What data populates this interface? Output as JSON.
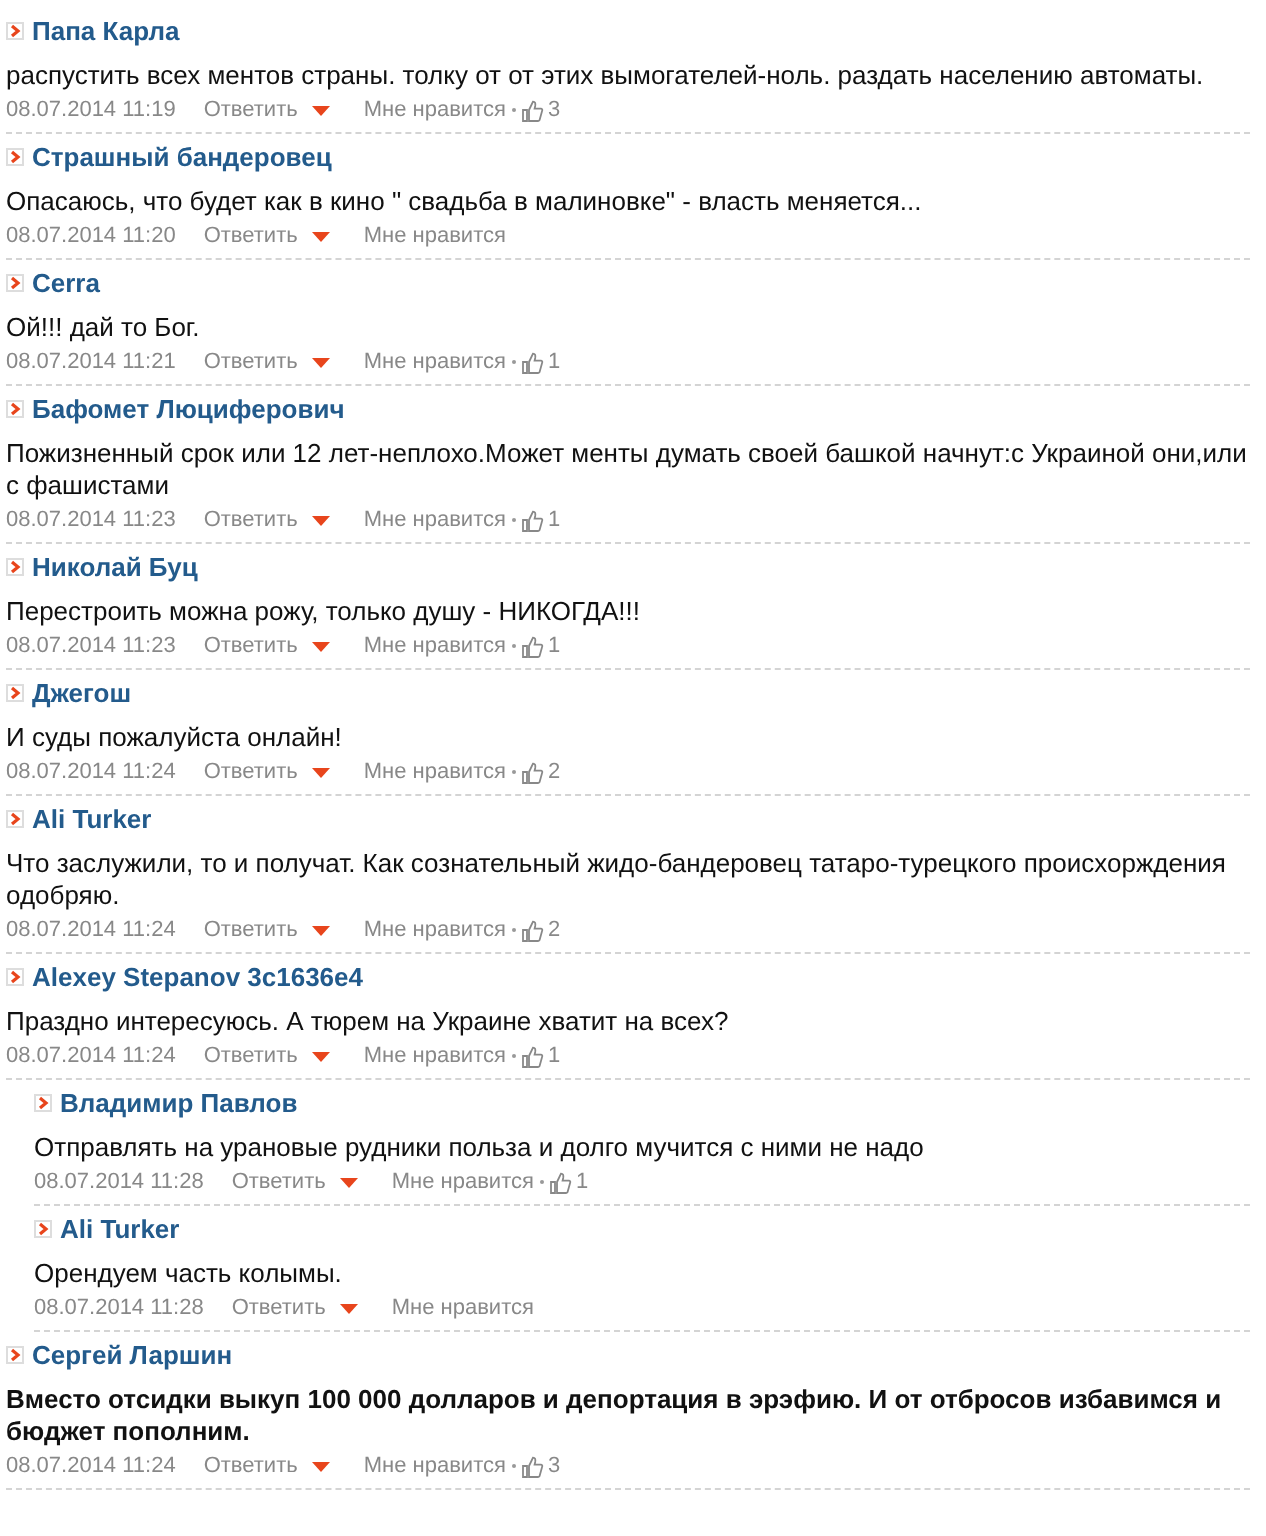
{
  "comments": [
    {
      "author": "Папа Карла",
      "text": "распустить всех ментов страны. толку от от этих вымогателей-ноль. раздать населению автоматы.",
      "bold": false,
      "date": "08.07.2014 11:19",
      "reply": "Ответить",
      "like": "Мне нравится",
      "likes": "3"
    },
    {
      "author": "Страшный бандеровец",
      "text": "Опасаюсь, что будет как в кино \" свадьба в малиновке\" - власть меняется...",
      "bold": false,
      "date": "08.07.2014 11:20",
      "reply": "Ответить",
      "like": "Мне нравится"
    },
    {
      "author": "Cerra",
      "text": "Ой!!! дай то Бог.",
      "bold": false,
      "date": "08.07.2014 11:21",
      "reply": "Ответить",
      "like": "Мне нравится",
      "likes": "1"
    },
    {
      "author": "Бафомет Люциферович",
      "text": "Пожизненный срок или 12 лет-неплохо.Может менты думать своей башкой начнут:с Украиной они,или с фашистами",
      "bold": false,
      "date": "08.07.2014 11:23",
      "reply": "Ответить",
      "like": "Мне нравится",
      "likes": "1"
    },
    {
      "author": "Николай Буц",
      "text": "Перестроить можна рожу, только душу - НИКОГДА!!!",
      "bold": false,
      "date": "08.07.2014 11:23",
      "reply": "Ответить",
      "like": "Мне нравится",
      "likes": "1"
    },
    {
      "author": "Джегош",
      "text": "И суды пожалуйста онлайн!",
      "bold": false,
      "date": "08.07.2014 11:24",
      "reply": "Ответить",
      "like": "Мне нравится",
      "likes": "2"
    },
    {
      "author": "Ali Turker",
      "text": "Что заслужили, то и получат. Как сознательный жидо-бандеровец татаро-турецкого происхорждения одобряю.",
      "bold": false,
      "date": "08.07.2014 11:24",
      "reply": "Ответить",
      "like": "Мне нравится",
      "likes": "2"
    },
    {
      "author": "Alexey Stepanov 3c1636e4",
      "text": "Праздно интересуюсь. А тюрем на Украине хватит на всех?",
      "bold": false,
      "date": "08.07.2014 11:24",
      "reply": "Ответить",
      "like": "Мне нравится",
      "likes": "1",
      "children": [
        {
          "author": "Владимир Павлов",
          "text": "Отправлять на урановые рудники польза и долго мучится с ними не надо",
          "bold": false,
          "date": "08.07.2014 11:28",
          "reply": "Ответить",
          "like": "Мне нравится",
          "likes": "1"
        },
        {
          "author": "Ali Turker",
          "text": "Орендуем часть колымы.",
          "bold": false,
          "date": "08.07.2014 11:28",
          "reply": "Ответить",
          "like": "Мне нравится"
        }
      ]
    },
    {
      "author": "Сергей Ларшин",
      "text": "Вместо отсидки выкуп 100 000 долларов и депортация в эрэфию. И от отбросов избавимся и бюджет пополним.",
      "bold": true,
      "date": "08.07.2014 11:24",
      "reply": "Ответить",
      "like": "Мне нравится",
      "likes": "3"
    }
  ]
}
